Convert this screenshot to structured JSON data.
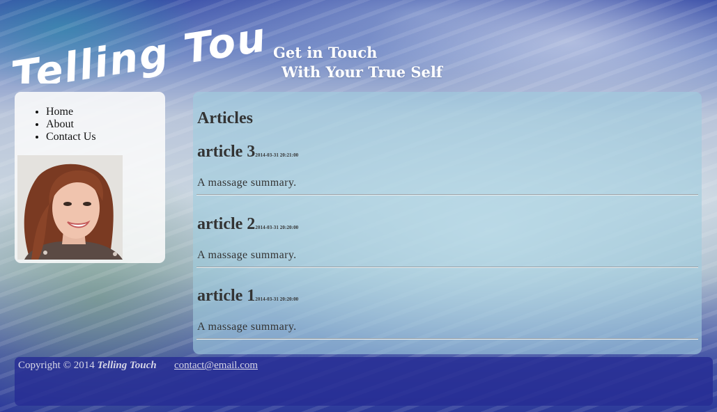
{
  "header": {
    "logo_text": "Telling Touch",
    "tagline_line1": "Get in Touch",
    "tagline_line2": "With Your True Self"
  },
  "sidebar": {
    "nav": [
      {
        "label": "Home"
      },
      {
        "label": "About"
      },
      {
        "label": "Contact Us"
      }
    ]
  },
  "main": {
    "heading": "Articles",
    "articles": [
      {
        "title": "article 3",
        "date": "2014-03-31 20:21:00",
        "summary": "A massage summary."
      },
      {
        "title": "article 2",
        "date": "2014-03-31 20:20:00",
        "summary": "A massage summary."
      },
      {
        "title": "article 1",
        "date": "2014-03-31 20:20:00",
        "summary": "A massage summary."
      }
    ]
  },
  "footer": {
    "copyright_prefix": "Copyright © 2014",
    "brand": "Telling Touch",
    "contact_email": "contact@email.com"
  },
  "colors": {
    "footer_bg": "#262c94",
    "panel_bg": "#a0cdde",
    "sidebar_bg": "#fafafa",
    "text": "#333333"
  }
}
